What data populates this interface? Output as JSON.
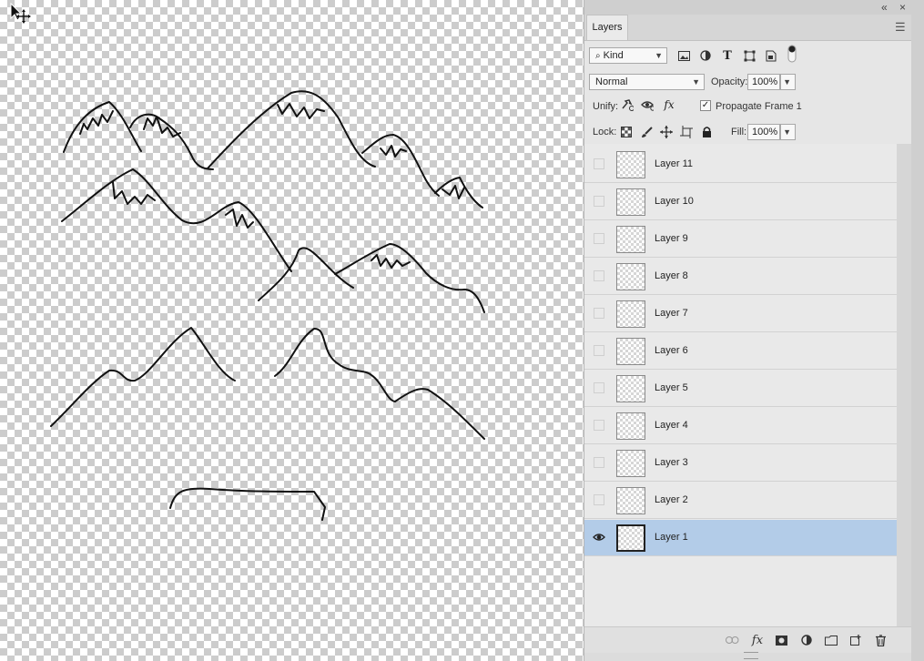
{
  "panel": {
    "tab_label": "Layers",
    "collapse_icon": "double-chevron-left-icon",
    "close_icon": "close-icon",
    "menu_icon": "hamburger-menu-icon"
  },
  "filter": {
    "kind_label": "Kind",
    "icons": [
      "image-filter-icon",
      "adjustment-filter-icon",
      "type-filter-icon",
      "shape-filter-icon",
      "smart-object-filter-icon"
    ]
  },
  "blend": {
    "mode": "Normal",
    "opacity_label": "Opacity:",
    "opacity_value": "100%"
  },
  "unify": {
    "label": "Unify:",
    "propagate_label": "Propagate Frame 1",
    "propagate_checked": true
  },
  "lock": {
    "label": "Lock:",
    "fill_label": "Fill:",
    "fill_value": "100%"
  },
  "layers": [
    {
      "name": "Layer 11",
      "visible": false,
      "selected": false
    },
    {
      "name": "Layer 10",
      "visible": false,
      "selected": false
    },
    {
      "name": "Layer 9",
      "visible": false,
      "selected": false
    },
    {
      "name": "Layer 8",
      "visible": false,
      "selected": false
    },
    {
      "name": "Layer 7",
      "visible": false,
      "selected": false
    },
    {
      "name": "Layer 6",
      "visible": false,
      "selected": false
    },
    {
      "name": "Layer 5",
      "visible": false,
      "selected": false
    },
    {
      "name": "Layer 4",
      "visible": false,
      "selected": false
    },
    {
      "name": "Layer 3",
      "visible": false,
      "selected": false
    },
    {
      "name": "Layer 2",
      "visible": false,
      "selected": false
    },
    {
      "name": "Layer 1",
      "visible": true,
      "selected": true
    }
  ],
  "footer_icons": [
    "link-layers-icon",
    "fx-icon",
    "layer-mask-icon",
    "adjustment-layer-icon",
    "new-group-icon",
    "new-layer-icon",
    "delete-icon"
  ],
  "colors": {
    "selection": "#b3cce8",
    "panel_bg": "#e6e6e6"
  }
}
